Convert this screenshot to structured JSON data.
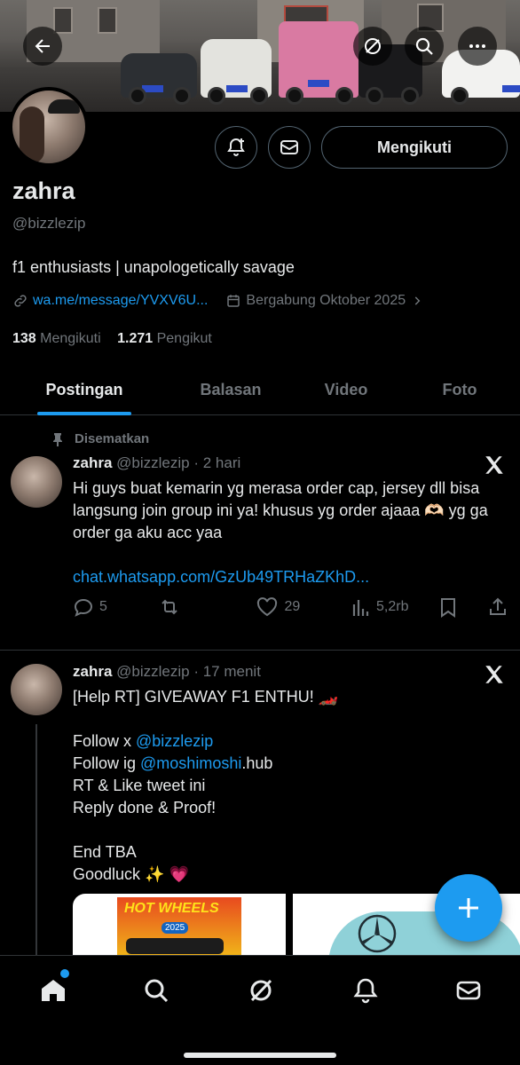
{
  "header": {
    "back_icon": "arrow-left-icon",
    "grok_icon": "slash-circle-icon",
    "search_icon": "search-icon",
    "more_icon": "more-horizontal-icon"
  },
  "banner": {
    "plates": [
      "",
      "",
      "",
      ""
    ]
  },
  "profile": {
    "name": "zahra",
    "handle": "@bizzlezip",
    "bio": "f1 enthusiasts | unapologetically savage",
    "link": "wa.me/message/YVXV6U...",
    "joined": "Bergabung Oktober 2025",
    "following_count": "138",
    "following_label": "Mengikuti",
    "followers_count": "1.271",
    "followers_label": "Pengikut",
    "follow_button": "Mengikuti"
  },
  "tabs": [
    "Postingan",
    "Balasan",
    "Video",
    "Foto"
  ],
  "posts": [
    {
      "pinned_label": "Disematkan",
      "name": "zahra",
      "handle": "@bizzlezip",
      "time": "· 2 hari",
      "text": "Hi guys buat kemarin yg merasa order cap, jersey dll bisa langsung join group ini ya! khusus yg order ajaaa 🫶🏻 yg ga order ga aku acc yaa",
      "link": "chat.whatsapp.com/GzUb49TRHaZKhD...",
      "replies": "5",
      "reposts": "",
      "likes": "29",
      "views": "5,2rb"
    },
    {
      "name": "zahra",
      "handle": "@bizzlezip",
      "time": "· 17 menit",
      "line1": "[Help RT] GIVEAWAY F1 ENTHU! 🏎️",
      "follow_x_prefix": "Follow x ",
      "follow_x_handle": "@bizzlezip",
      "follow_ig_prefix": "Follow ig ",
      "follow_ig_handle": "@moshimoshi",
      "follow_ig_suffix": ".hub",
      "line4": "RT & Like tweet ini",
      "line5": "Reply done & Proof!",
      "line6": "End TBA",
      "line7": "Goodluck ✨ 💗",
      "media1_text": "HOT WHEELS",
      "media1_year": "2025"
    }
  ],
  "fab_icon": "plus-icon",
  "bottom_nav": [
    "home-icon",
    "search-icon",
    "grok-icon",
    "notifications-icon",
    "messages-icon"
  ],
  "colors": {
    "accent": "#1d9bf0",
    "text": "#e7e9ea",
    "muted": "#71767b",
    "bg": "#000000"
  }
}
